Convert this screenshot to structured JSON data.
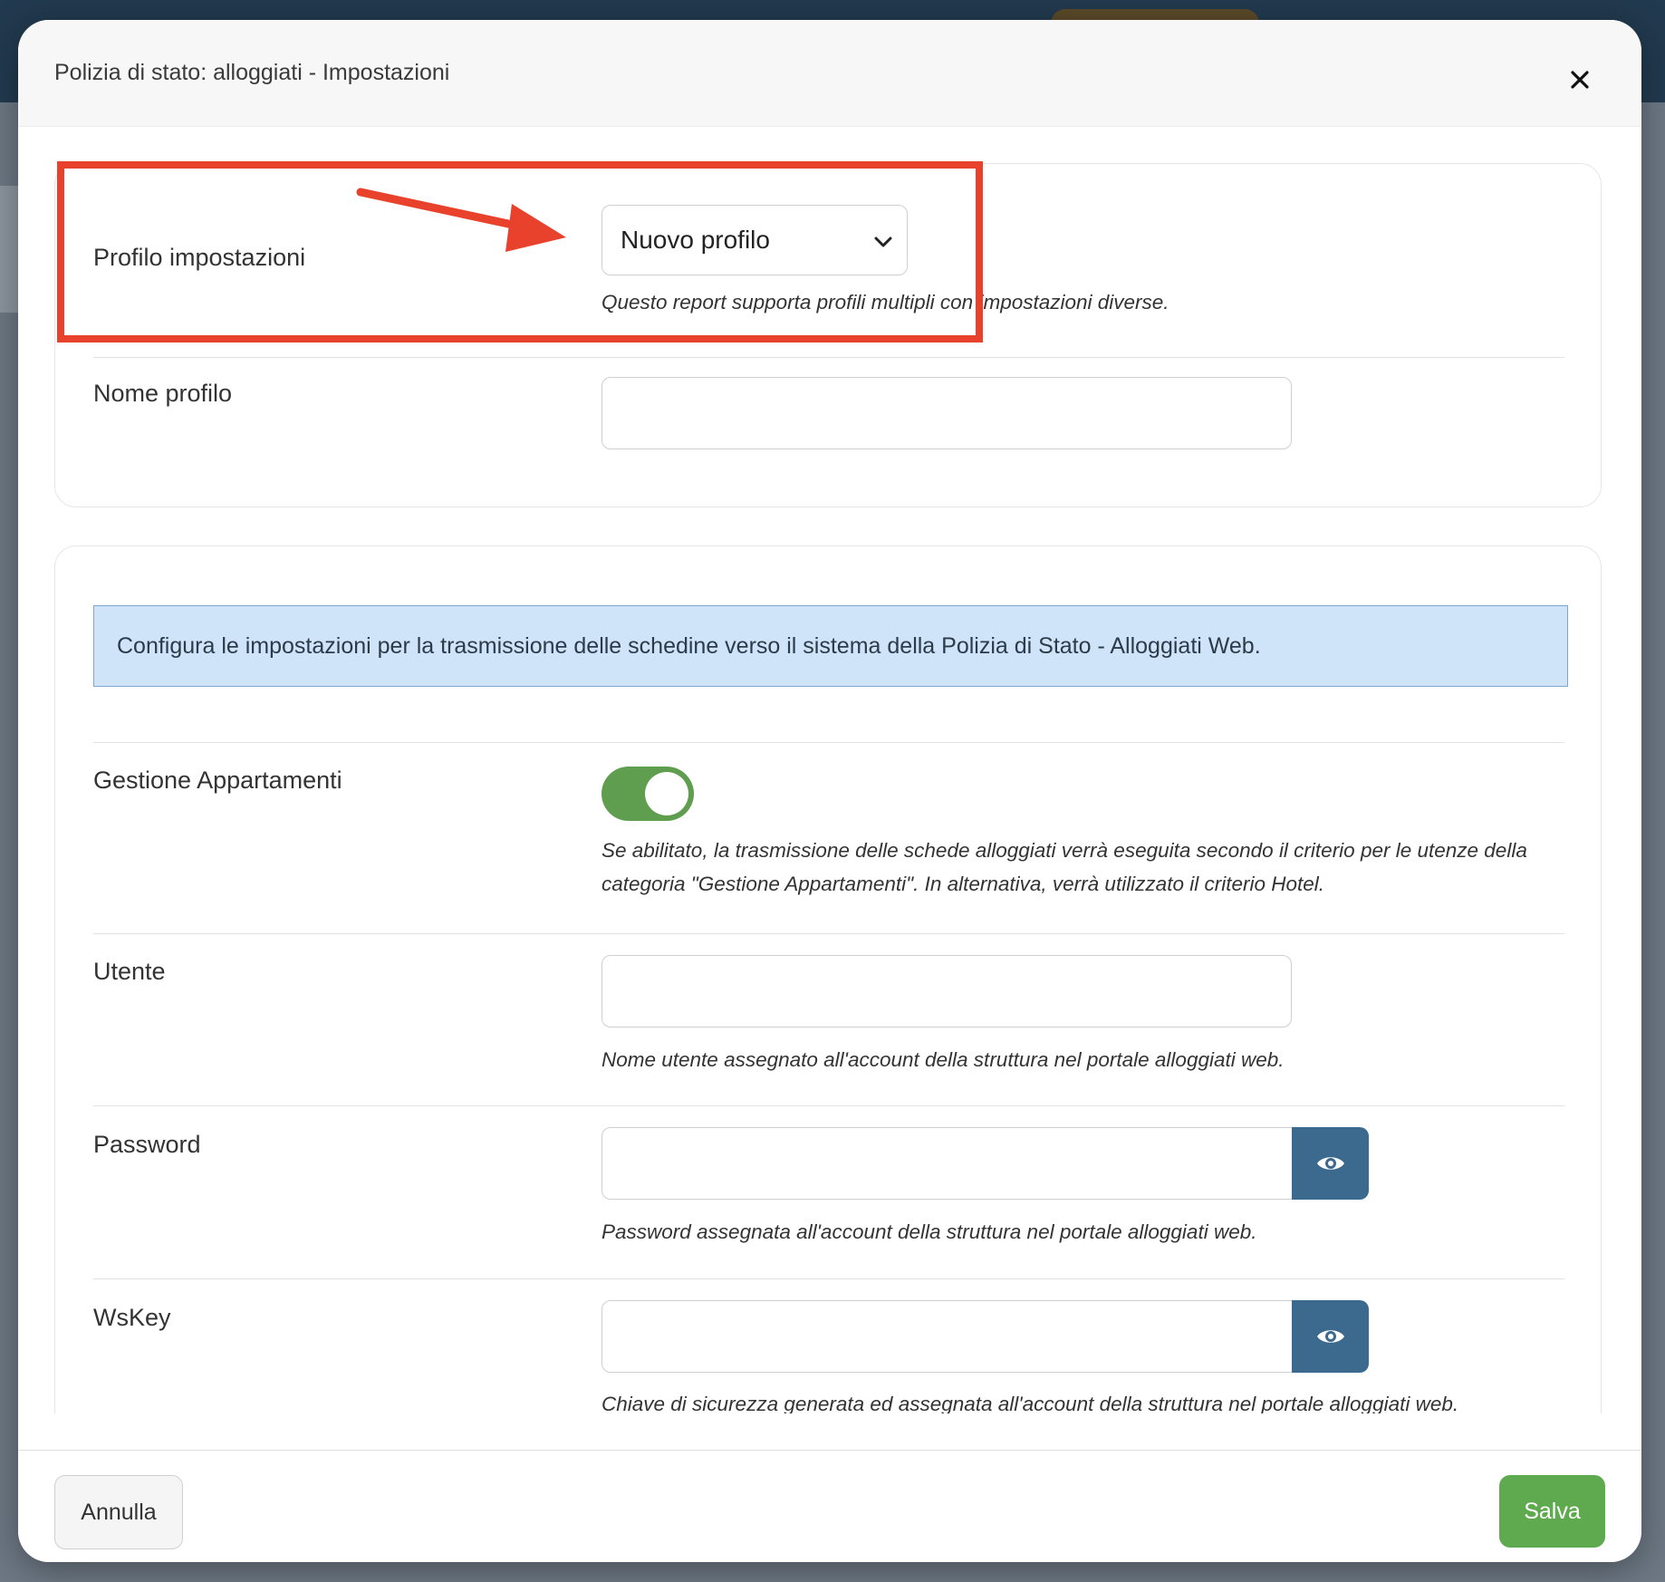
{
  "modal": {
    "title": "Polizia di stato: alloggiati - Impostazioni"
  },
  "profile": {
    "label": "Profilo impostazioni",
    "selected": "Nuovo profilo",
    "help": "Questo report supporta profili multipli con impostazioni diverse.",
    "name_label": "Nome profilo",
    "name_value": ""
  },
  "info": {
    "text": "Configura le impostazioni per la trasmissione delle schedine verso il sistema della Polizia di Stato - Alloggiati Web."
  },
  "apartments": {
    "label": "Gestione Appartamenti",
    "enabled": true,
    "help": "Se abilitato, la trasmissione delle schede alloggiati verrà eseguita secondo il criterio per le utenze della categoria \"Gestione Appartamenti\". In alternativa, verrà utilizzato il criterio Hotel."
  },
  "user": {
    "label": "Utente",
    "value": "",
    "help": "Nome utente assegnato all'account della struttura nel portale alloggiati web."
  },
  "password": {
    "label": "Password",
    "value": "",
    "help": "Password assegnata all'account della struttura nel portale alloggiati web."
  },
  "wskey": {
    "label": "WsKey",
    "value": "",
    "help": "Chiave di sicurezza generata ed assegnata all'account della struttura nel portale alloggiati web."
  },
  "footer": {
    "cancel_label": "Annulla",
    "save_label": "Salva"
  },
  "colors": {
    "accent_green": "#5faa4f",
    "eye_button": "#3c6a8f",
    "info_bg": "#cfe4f9",
    "annotation_red": "#e8412c"
  },
  "icons": {
    "close": "close-icon",
    "chevron": "chevron-down-icon",
    "eye": "eye-icon",
    "annotation_arrow": "arrow-icon"
  }
}
